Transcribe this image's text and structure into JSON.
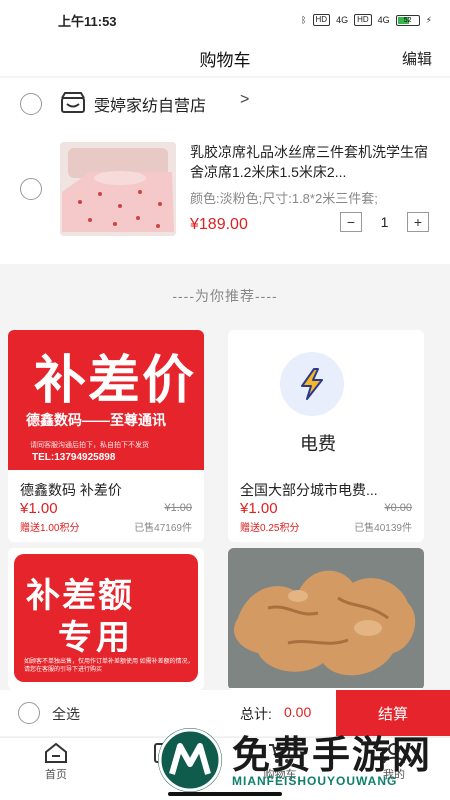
{
  "status": {
    "time": "上午11:53",
    "network_a": "4G",
    "network_b": "4G",
    "hd": "HD",
    "battery": "52"
  },
  "header": {
    "title": "购物车",
    "edit_label": "编辑"
  },
  "cart": {
    "store_name": "雯婷家纺自营店",
    "item": {
      "title": "乳胶凉席礼品冰丝席三件套机洗学生宿舍凉席1.2米床1.5米床2...",
      "spec": "颜色:淡粉色;尺寸:1.8*2米三件套;",
      "price": "¥189.00",
      "quantity": "1",
      "minus": "−",
      "plus": "+"
    }
  },
  "recommend": {
    "title": "----为你推荐----",
    "products": [
      {
        "name": "德鑫数码 补差价",
        "price": "¥1.00",
        "orig_price": "¥1.00",
        "points": "赠送1.00积分",
        "sold": "已售47169件",
        "img_big": "补差价",
        "img_line": "德鑫数码——至尊通讯",
        "img_small": "请同客服沟通后拍下，私自拍下不发货",
        "img_tel": "TEL:13794925898"
      },
      {
        "name": "全国大部分城市电费...",
        "price": "¥1.00",
        "orig_price": "¥0.00",
        "points": "赠送0.25积分",
        "sold": "已售40139件",
        "img_label": "电费"
      },
      {
        "img_t1": "补差额",
        "img_t2": "专用",
        "img_small": "如顾客不单独出售，仅用作订单补差额使用 如需补差额的情况，请您在客服的引导下进行购买"
      },
      {
        "img_alt": "ginger"
      }
    ]
  },
  "bottom": {
    "select_all": "全选",
    "total_label": "总计:",
    "total_value": "0.00",
    "checkout": "结算"
  },
  "tabs": [
    {
      "label": "首页",
      "icon": "home-icon"
    },
    {
      "label": "",
      "icon": "category-icon"
    },
    {
      "label": "购物车",
      "icon": "cart-icon"
    },
    {
      "label": "我的",
      "icon": "user-icon"
    }
  ],
  "watermark": {
    "text": "免费手游网",
    "sub": "MIANFEISHOUYOUWANG",
    "logo_letter": "M"
  },
  "colors": {
    "accent": "#e5242b",
    "price": "#e02020",
    "watermark_green": "#0e7f6d"
  }
}
